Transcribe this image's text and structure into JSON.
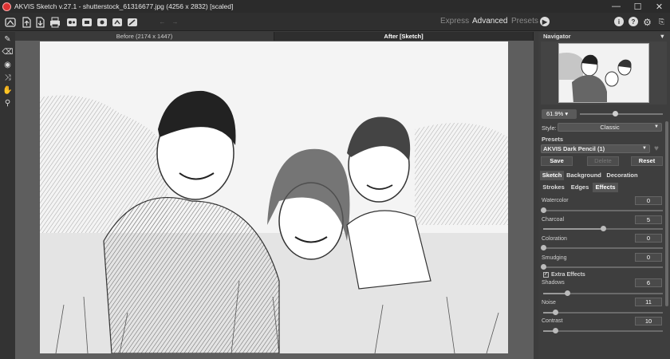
{
  "window": {
    "title": "AKVIS Sketch v.27.1 - shutterstock_61316677.jpg (4256 x 2832) [scaled]"
  },
  "toolbar": {
    "modes": [
      {
        "label": "Express",
        "active": false
      },
      {
        "label": "Advanced",
        "active": true
      },
      {
        "label": "Presets",
        "active": false
      }
    ],
    "icons": [
      "home-icon",
      "open-file-icon",
      "save-file-icon",
      "print-icon",
      "share-icon",
      "batch-icon",
      "settings-alt-icon",
      "plugin-icon",
      "brush-presets-icon",
      "undo-icon",
      "redo-icon"
    ],
    "play_icon": "play-icon",
    "info_label": "i",
    "help_label": "?",
    "colors": {
      "bg": "#2f2f2f",
      "icon": "#dddddd",
      "inactive": "#8a8a8a"
    }
  },
  "tools": [
    "pencil-icon",
    "eraser-icon",
    "smudge-icon",
    "crop-icon",
    "hand-icon",
    "zoom-icon"
  ],
  "canvas": {
    "tabs": [
      {
        "label": "Before (2174 x 1447)",
        "active": false
      },
      {
        "label": "After [Sketch]",
        "active": true
      }
    ]
  },
  "panel": {
    "navigator": {
      "title": "Navigator"
    },
    "zoom": {
      "value": "61.9%"
    },
    "style": {
      "label": "Style:",
      "value": "Classic"
    },
    "presets": {
      "label": "Presets",
      "value": "AKVIS Dark Pencil (1)",
      "save": "Save",
      "delete": "Delete",
      "reset": "Reset"
    },
    "main_tabs": [
      {
        "label": "Sketch",
        "active": true
      },
      {
        "label": "Background",
        "active": false
      },
      {
        "label": "Decoration",
        "active": false
      }
    ],
    "sub_tabs": [
      {
        "label": "Strokes",
        "active": false
      },
      {
        "label": "Edges",
        "active": false
      },
      {
        "label": "Effects",
        "active": true
      }
    ],
    "params": [
      {
        "label": "Watercolor",
        "value": "0",
        "fraction": 0.0
      },
      {
        "label": "Charcoal",
        "value": "5",
        "fraction": 0.5
      },
      {
        "label": "Coloration",
        "value": "0",
        "fraction": 0.0
      },
      {
        "label": "Smudging",
        "value": "0",
        "fraction": 0.0
      }
    ],
    "extra": {
      "label": "Extra Effects",
      "checked": true
    },
    "extra_params": [
      {
        "label": "Shadows",
        "value": "6",
        "fraction": 0.2
      },
      {
        "label": "Noise",
        "value": "11",
        "fraction": 0.1
      },
      {
        "label": "Contrast",
        "value": "10",
        "fraction": 0.1
      }
    ]
  }
}
